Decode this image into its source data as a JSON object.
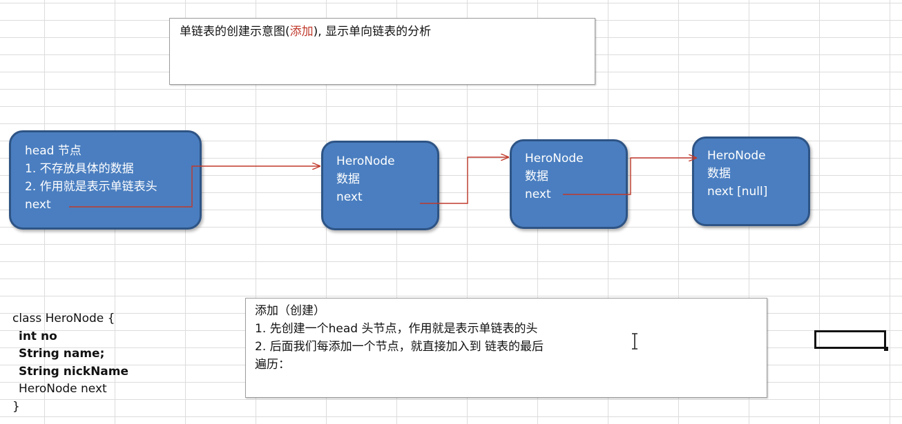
{
  "title_box": {
    "text_before": "单链表的创建示意图(",
    "text_red": "添加",
    "text_after": "), 显示单向链表的分析"
  },
  "head_node": {
    "lines": [
      "head 节点",
      "1. 不存放具体的数据",
      "2. 作用就是表示单链表头",
      "next"
    ]
  },
  "nodes": [
    {
      "lines": [
        "HeroNode",
        "数据",
        "next"
      ]
    },
    {
      "lines": [
        "HeroNode",
        "数据",
        "next"
      ]
    },
    {
      "lines": [
        "HeroNode",
        "数据",
        "next [null]"
      ]
    }
  ],
  "class_def": {
    "lines": [
      "class HeroNode {",
      "int no",
      "String name;",
      "String nickName",
      "HeroNode next",
      "}"
    ]
  },
  "notes_box": {
    "lines": [
      "添加（创建）",
      "1. 先创建一个head 头节点，作用就是表示单链表的头",
      "2. 后面我们每添加一个节点，就直接加入到 链表的最后",
      "遍历："
    ]
  },
  "colors": {
    "node_fill": "#4a7ec0",
    "node_border": "#2e5485",
    "arrow": "#c0392b",
    "title_accent": "#c0392b",
    "grid": "#dcdcdc"
  },
  "icons": [
    "text-cursor-icon",
    "arrow-icon"
  ]
}
